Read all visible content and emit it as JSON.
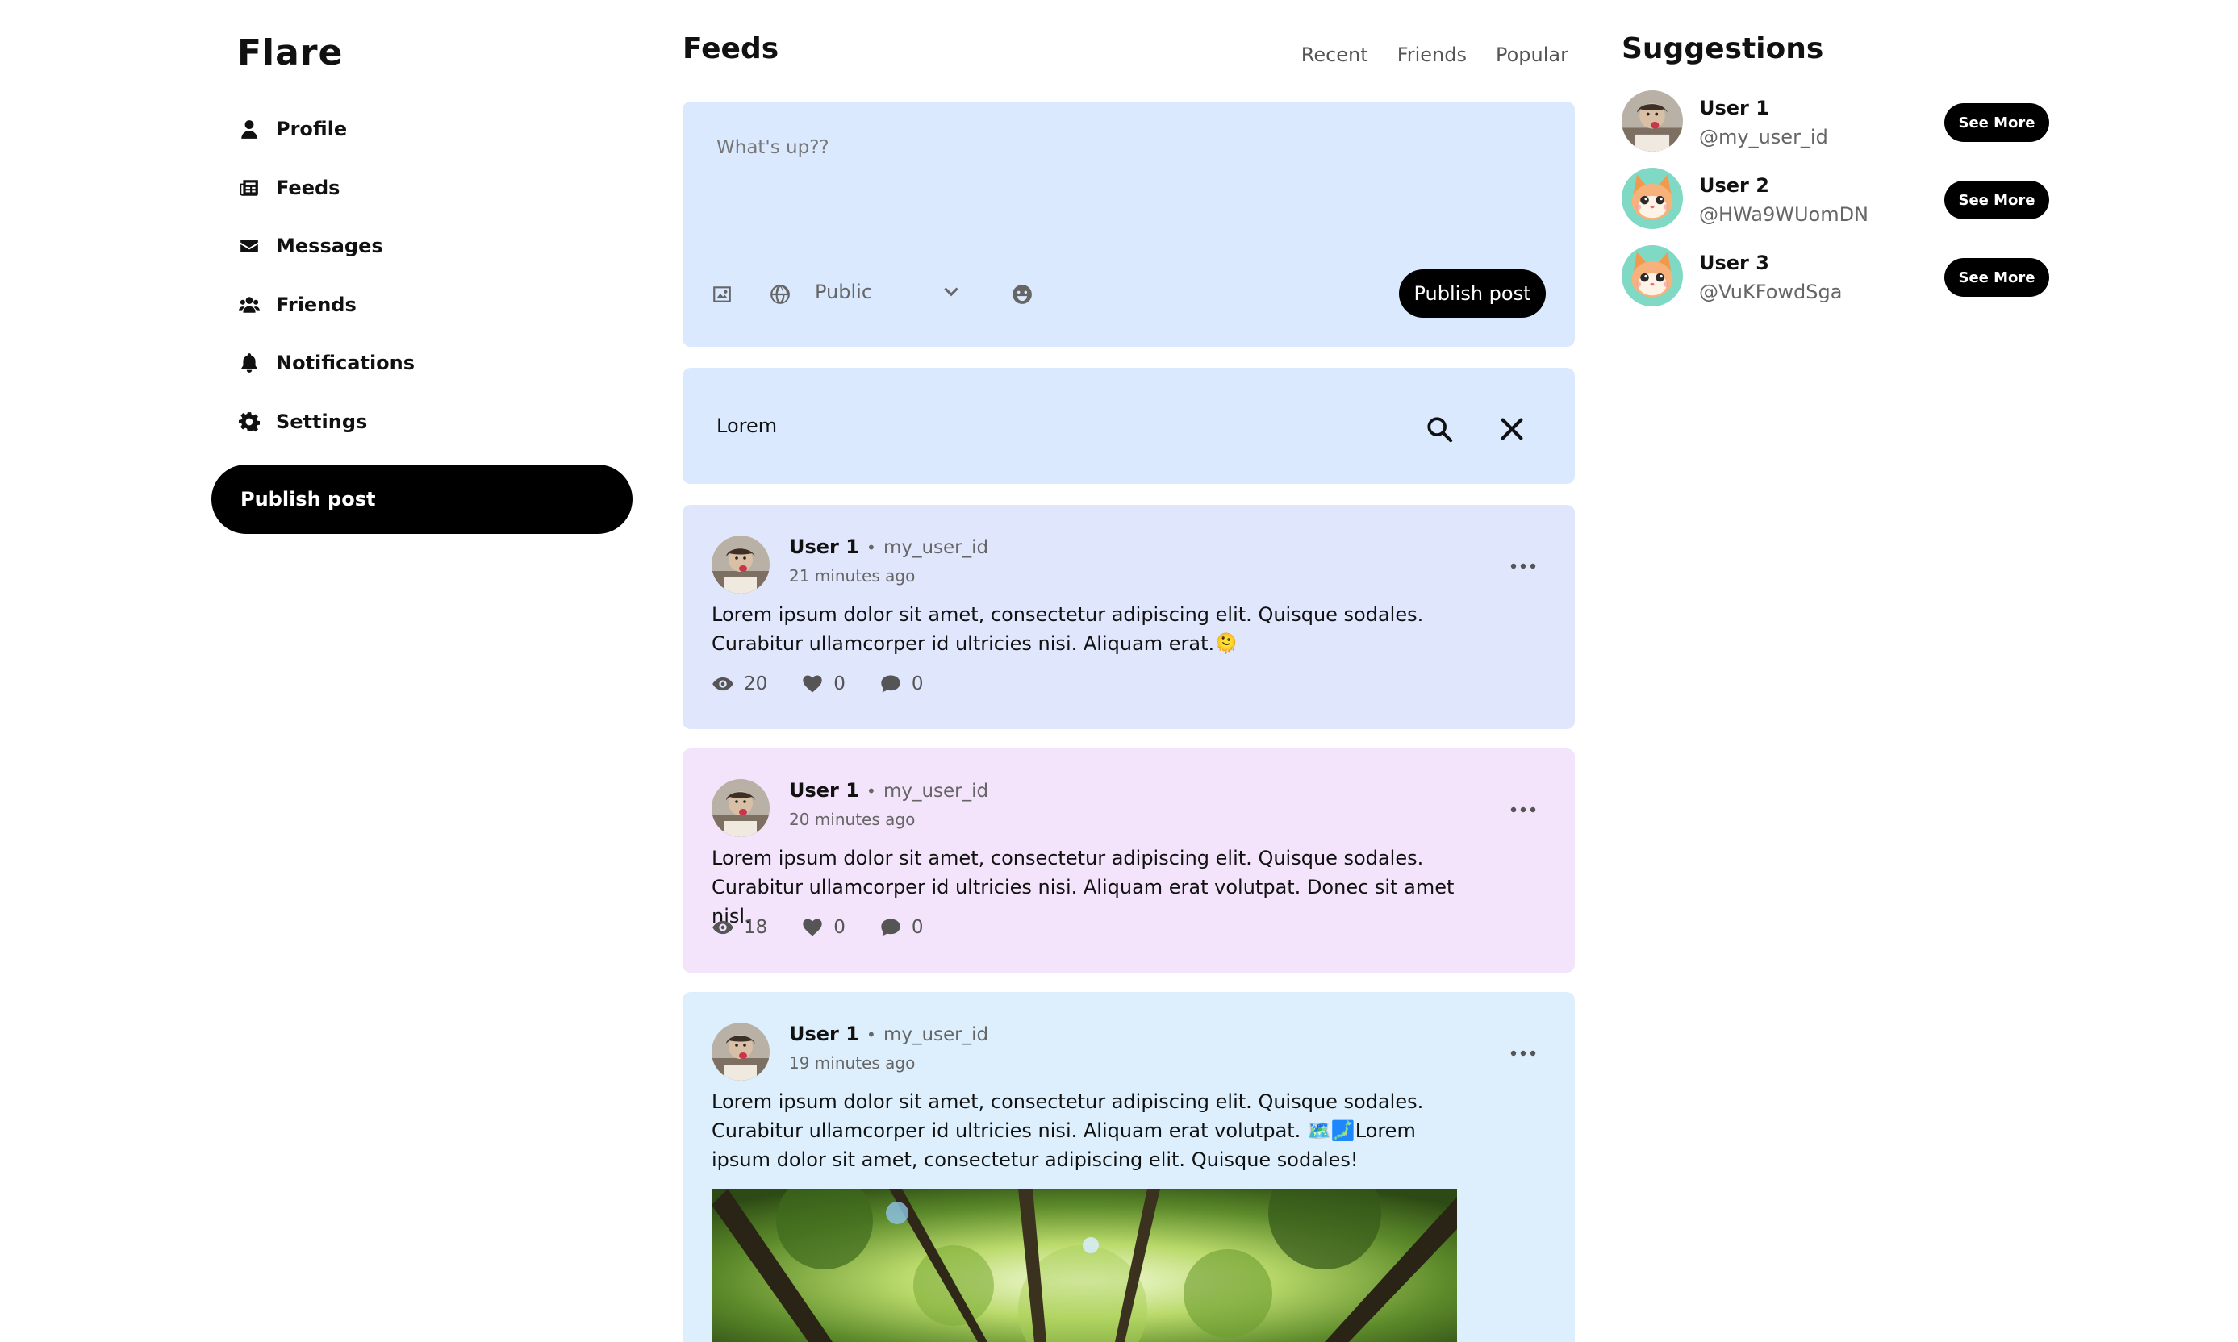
{
  "app": {
    "name": "Flare"
  },
  "sidebar": {
    "items": [
      {
        "label": "Profile",
        "icon": "user-icon"
      },
      {
        "label": "Feeds",
        "icon": "newspaper-icon"
      },
      {
        "label": "Messages",
        "icon": "envelope-icon"
      },
      {
        "label": "Friends",
        "icon": "users-icon"
      },
      {
        "label": "Notifications",
        "icon": "bell-icon"
      },
      {
        "label": "Settings",
        "icon": "gear-icon"
      }
    ],
    "publish_label": "Publish post"
  },
  "main": {
    "title": "Feeds",
    "tabs": [
      {
        "label": "Recent"
      },
      {
        "label": "Friends"
      },
      {
        "label": "Popular"
      }
    ],
    "composer": {
      "placeholder": "What's up??",
      "privacy": "Public",
      "publish_label": "Publish post"
    },
    "search": {
      "value": "Lorem"
    },
    "posts": [
      {
        "author": "User 1",
        "handle": "my_user_id",
        "time": "21 minutes ago",
        "text": "Lorem ipsum dolor sit amet, consectetur adipiscing elit. Quisque sodales. Curabitur ullamcorper id ultricies nisi. Aliquam erat.🫠",
        "views": "20",
        "likes": "0",
        "comments": "0",
        "bg": "#e0e6fc"
      },
      {
        "author": "User 1",
        "handle": "my_user_id",
        "time": "20 minutes ago",
        "text": "Lorem ipsum dolor sit amet, consectetur adipiscing elit. Quisque sodales. Curabitur ullamcorper id ultricies nisi. Aliquam erat volutpat. Donec sit amet nisl.",
        "views": "18",
        "likes": "0",
        "comments": "0",
        "bg": "#f3e4fc"
      },
      {
        "author": "User 1",
        "handle": "my_user_id",
        "time": "19 minutes ago",
        "text": "Lorem ipsum dolor sit amet, consectetur adipiscing elit. Quisque sodales. Curabitur ullamcorper id ultricies nisi. Aliquam erat volutpat. 🗺️🗾Lorem ipsum dolor sit amet, consectetur adipiscing elit. Quisque sodales!",
        "bg": "#ddeffc"
      }
    ]
  },
  "suggestions": {
    "title": "Suggestions",
    "button_label": "See More",
    "users": [
      {
        "name": "User 1",
        "handle": "@my_user_id"
      },
      {
        "name": "User 2",
        "handle": "@HWa9WUomDN"
      },
      {
        "name": "User 3",
        "handle": "@VuKFowdSga"
      }
    ]
  },
  "colors": {
    "panel": "#dae9fd",
    "primary_button": "#000000",
    "muted_text": "#666666"
  }
}
